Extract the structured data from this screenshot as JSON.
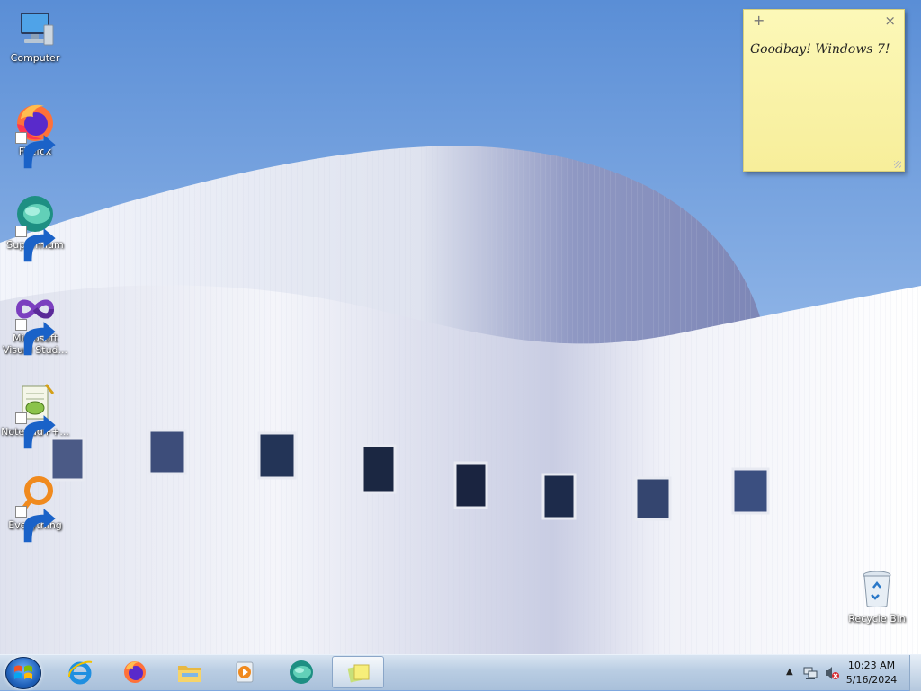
{
  "desktop": {
    "icons": [
      {
        "label": "Computer",
        "icon": "computer-icon",
        "shortcut": false
      },
      {
        "label": "Firefox",
        "icon": "firefox-icon",
        "shortcut": true
      },
      {
        "label": "Supermium",
        "icon": "supermium-icon",
        "shortcut": true
      },
      {
        "label": "Microsoft Visual Stud...",
        "icon": "visual-studio-icon",
        "shortcut": true
      },
      {
        "label": "Notepad++...",
        "icon": "notepadpp-icon",
        "shortcut": true
      },
      {
        "label": "Everything",
        "icon": "everything-icon",
        "shortcut": true
      },
      {
        "label": "Recycle Bin",
        "icon": "recycle-bin-icon",
        "shortcut": false
      }
    ]
  },
  "sticky_note": {
    "text": "Goodbay! Windows 7!",
    "add_glyph": "+",
    "close_glyph": "×",
    "color": "#f9f3a8"
  },
  "taskbar": {
    "pinned": [
      "start-orb",
      "internet-explorer-icon",
      "firefox-icon",
      "file-explorer-icon",
      "media-player-icon",
      "supermium-icon",
      "sticky-notes-icon"
    ],
    "active": "sticky-notes-icon",
    "tray": {
      "overflow_glyph": "▲",
      "time": "10:23 AM",
      "date": "5/16/2024"
    }
  },
  "colors": {
    "sky": "#7fa8df",
    "taskbar": "#b9cde3"
  }
}
